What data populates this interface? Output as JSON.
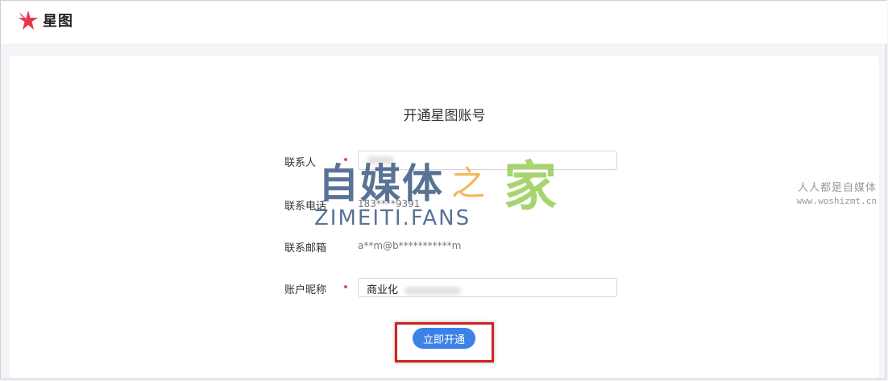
{
  "app": {
    "logo_text": "星图",
    "brand_color": "#e8354f"
  },
  "form": {
    "title": "开通星图账号",
    "fields": [
      {
        "label": "联系人",
        "required": true,
        "type": "input",
        "value": ""
      },
      {
        "label": "联系电话",
        "required": false,
        "type": "text",
        "value": "183****9391"
      },
      {
        "label": "联系邮箱",
        "required": false,
        "type": "text",
        "value": "a**m@b***********m"
      },
      {
        "label": "账户昵称",
        "required": true,
        "type": "input",
        "value": "商业化"
      }
    ],
    "submit_label": "立即开通",
    "accent_color": "#3c82e6"
  },
  "watermark": {
    "zh_main": "自媒体",
    "zh_mid": "之",
    "zh_end": "家",
    "en": "ZIMEITI.FANS",
    "side_cn": "人人都是自媒体",
    "side_url": "www.woshizmt.cn"
  }
}
